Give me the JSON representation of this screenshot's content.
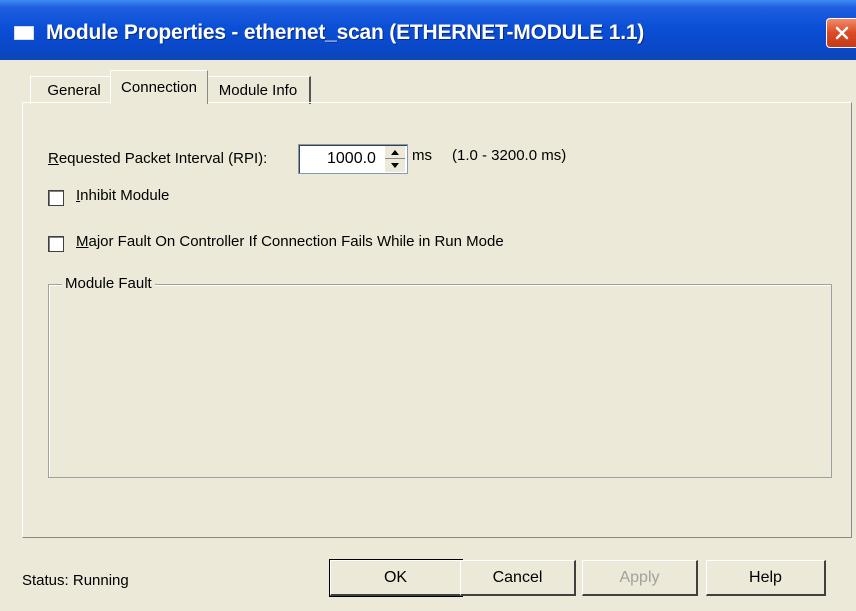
{
  "window": {
    "title": "Module Properties  - ethernet_scan (ETHERNET-MODULE 1.1)"
  },
  "tabs": [
    {
      "label": "General"
    },
    {
      "label": "Connection"
    },
    {
      "label": "Module Info"
    }
  ],
  "connection": {
    "rpi_label_first": "R",
    "rpi_label_rest": "equested Packet Interval (RPI):",
    "rpi_value": "1000.0",
    "rpi_unit": "ms",
    "rpi_range": "(1.0 - 3200.0 ms)",
    "inhibit_first": "I",
    "inhibit_rest": "nhibit Module",
    "inhibit_checked": false,
    "major_fault_first": "M",
    "major_fault_rest": "ajor Fault On Controller If Connection Fails While in Run Mode",
    "major_fault_checked": false,
    "module_fault_title": "Module Fault"
  },
  "footer": {
    "status": "Status:  Running",
    "ok_label": "OK",
    "cancel_label": "Cancel",
    "apply_label": "Apply",
    "help_label": "Help"
  }
}
